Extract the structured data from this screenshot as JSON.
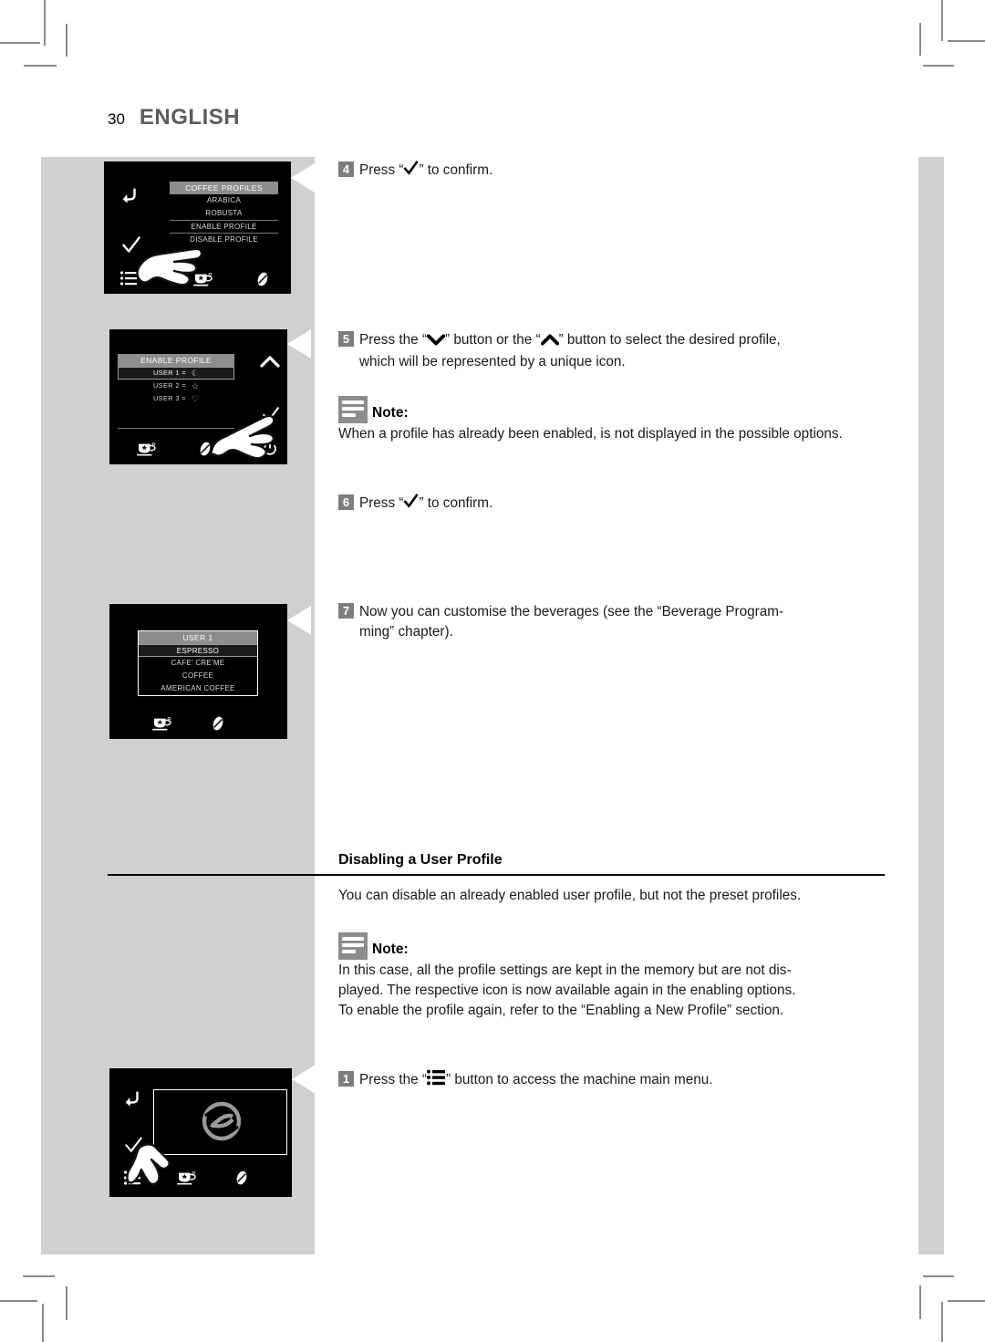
{
  "page": {
    "number": "30",
    "language": "ENGLISH"
  },
  "colors": {
    "panel_gray": "#d0d0d0",
    "badge_gray": "#7d7d7d",
    "screen_black": "#000000",
    "menu_header_gray": "#8d8d8d"
  },
  "screens": [
    {
      "id": "coffee-profiles",
      "title": "COFFEE PROFILES",
      "items": [
        "ARABICA",
        "ROBUSTA",
        "ENABLE PROFILE",
        "DISABLE PROFILE"
      ],
      "left_icons": [
        "back-arrow-icon",
        "checkmark-icon",
        "menu-list-icon"
      ],
      "bottom_icons": [
        "cup-profile-icon",
        "coffee-bean-icon"
      ],
      "hand_pointer": "pointing-hand-icon"
    },
    {
      "id": "enable-profile",
      "title": "ENABLE PROFILE",
      "rows": [
        {
          "label": "USER 1 =",
          "glyph": "moon-icon",
          "selected": true
        },
        {
          "label": "USER 2 =",
          "glyph": "star-icon",
          "selected": false
        },
        {
          "label": "USER 3 =",
          "glyph": "heart-icon",
          "selected": false
        }
      ],
      "right_icons": [
        "chevron-up-icon",
        "checkmark-icon",
        "power-icon"
      ],
      "bottom_icons": [
        "cup-profile-icon",
        "coffee-bean-icon"
      ],
      "hand_pointer": "pointing-hand-icon"
    },
    {
      "id": "user-1",
      "title": "USER 1",
      "items": [
        "ESPRESSO",
        "CAFE' CRE'ME",
        "COFFEE",
        "AMERICAN COFFEE"
      ],
      "bottom_icons": [
        "cup-profile-icon",
        "coffee-bean-icon"
      ]
    },
    {
      "id": "main-logo",
      "logo": "saeco-logo-icon",
      "left_icons": [
        "back-arrow-icon",
        "checkmark-icon",
        "menu-list-icon"
      ],
      "bottom_icons": [
        "menu-list-icon",
        "cup-profile-icon",
        "coffee-bean-icon"
      ],
      "hand_pointer": "pointing-hand-icon"
    }
  ],
  "steps": {
    "step4": {
      "number": "4",
      "before": "Press “",
      "glyph": "checkmark-icon",
      "after": "” to confirm."
    },
    "step5": {
      "number": "5",
      "part1": "Press the “",
      "glyph1": "chevron-down-icon",
      "part2": "” button or the “",
      "glyph2": "chevron-up-icon",
      "part3": "” button to select the desired profile,",
      "line2": "which will be represented by a unique icon."
    },
    "step6": {
      "number": "6",
      "before": "Press “",
      "glyph": "checkmark-icon",
      "after": "” to confirm."
    },
    "step7": {
      "number": "7",
      "line1": "Now you can customise the beverages (see the “Beverage Program-",
      "line2": "ming” chapter)."
    },
    "step1": {
      "number": "1",
      "before": "Press the “",
      "glyph": "menu-list-icon",
      "after": "” button to access the machine main menu."
    }
  },
  "notes": {
    "note_top": {
      "label": "Note:",
      "text": "When a profile has already been enabled, is not displayed in the possible options."
    },
    "note_bottom": {
      "label": "Note:",
      "line1": "In this case, all the profile settings are kept in the memory but are not dis-",
      "line2": "played. The respective icon is now available again in the enabling options.",
      "line3": "To enable the profile again, refer to the “Enabling a New Profile” section."
    }
  },
  "section": {
    "heading": "Disabling a User Profile",
    "paragraph": "You can disable an already enabled user profile, but not the preset profiles."
  }
}
